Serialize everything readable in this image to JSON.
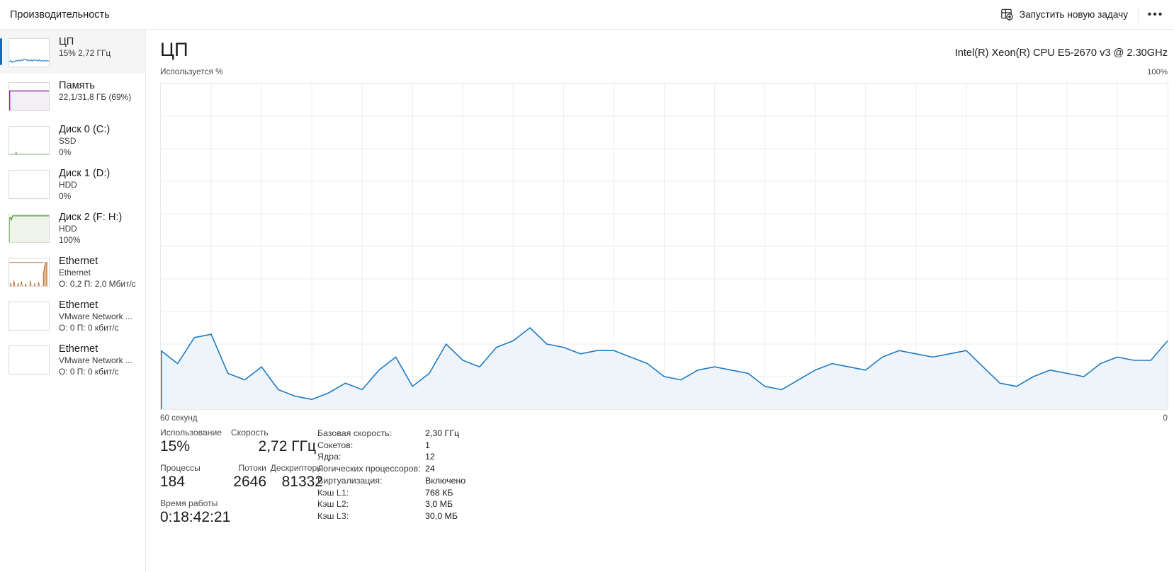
{
  "window": {
    "title": "Производительность",
    "new_task_label": "Запустить новую задачу",
    "new_task_icon": "new-window-plus-icon",
    "more_label": "•••"
  },
  "sidebar": {
    "items": [
      {
        "name": "cpu",
        "title": "ЦП",
        "sub1": "15% 2,72 ГГц",
        "sub2": "",
        "selected": true,
        "accent": "#1f7bc1",
        "fill": "none",
        "thumb": "line"
      },
      {
        "name": "memory",
        "title": "Память",
        "sub1": "22,1/31,8 ГБ (69%)",
        "sub2": "",
        "selected": false,
        "accent": "#8d21b0",
        "fill": "#f4eff5",
        "thumb": "flat-high"
      },
      {
        "name": "disk-0",
        "title": "Диск 0 (C:)",
        "sub1": "SSD",
        "sub2": "0%",
        "selected": false,
        "accent": "#4f9e2f",
        "fill": "none",
        "thumb": "flat-zero"
      },
      {
        "name": "disk-1",
        "title": "Диск 1 (D:)",
        "sub1": "HDD",
        "sub2": "0%",
        "selected": false,
        "accent": "#4f9e2f",
        "fill": "none",
        "thumb": "empty"
      },
      {
        "name": "disk-2",
        "title": "Диск 2 (F: H:)",
        "sub1": "HDD",
        "sub2": "100%",
        "selected": false,
        "accent": "#4f9e2f",
        "fill": "#eef4e9",
        "thumb": "flat-full"
      },
      {
        "name": "ethernet-1",
        "title": "Ethernet",
        "sub1": "Ethernet",
        "sub2": "О: 0,2 П: 2,0 Мбит/с",
        "selected": false,
        "accent": "#b5621b",
        "fill": "#fbf4ed",
        "thumb": "spiky"
      },
      {
        "name": "ethernet-2",
        "title": "Ethernet",
        "sub1": "VMware Network ...",
        "sub2": "О: 0 П: 0 кбит/с",
        "selected": false,
        "accent": "#b5621b",
        "fill": "none",
        "thumb": "empty"
      },
      {
        "name": "ethernet-3",
        "title": "Ethernet",
        "sub1": "VMware Network ...",
        "sub2": "О: 0 П: 0 кбит/с",
        "selected": false,
        "accent": "#b5621b",
        "fill": "none",
        "thumb": "empty"
      }
    ]
  },
  "main": {
    "heading": "ЦП",
    "model": "Intel(R) Xeon(R) CPU E5-2670 v3 @ 2.30GHz",
    "graph_top_left_label": "Используется %",
    "graph_top_right_label": "100%",
    "graph_bottom_left_label": "60 секунд",
    "graph_bottom_right_label": "0",
    "colors": {
      "line": "#1f7bc1",
      "fill": "#eef4fa",
      "grid": "#e9eef2",
      "accent": "#0f6cbd"
    }
  },
  "chart_data": {
    "type": "area",
    "title": "ЦП — Используется %",
    "xlabel": "60 секунд",
    "ylabel": "Используется %",
    "ylim": [
      0,
      100
    ],
    "xlim": [
      60,
      0
    ],
    "grid": true,
    "legend": "none",
    "series": [
      {
        "name": "Используется %",
        "values": [
          18,
          14,
          22,
          23,
          11,
          9,
          13,
          6,
          4,
          3,
          5,
          8,
          6,
          12,
          16,
          7,
          11,
          20,
          15,
          13,
          19,
          21,
          25,
          20,
          19,
          17,
          18,
          18,
          16,
          14,
          10,
          9,
          12,
          13,
          12,
          11,
          7,
          6,
          9,
          12,
          14,
          13,
          12,
          16,
          18,
          17,
          16,
          17,
          18,
          13,
          8,
          7,
          10,
          12,
          11,
          10,
          14,
          16,
          15,
          15,
          21
        ]
      }
    ]
  },
  "stats": {
    "utilization_label": "Использование",
    "utilization_value": "15%",
    "speed_label": "Скорость",
    "speed_value": "2,72 ГГц",
    "processes_label": "Процессы",
    "processes_value": "184",
    "threads_label": "Потоки",
    "threads_value": "2646",
    "handles_label": "Дескрипторы",
    "handles_value": "81332",
    "uptime_label": "Время работы",
    "uptime_value": "0:18:42:21"
  },
  "specs": [
    {
      "key": "Базовая скорость:",
      "value": "2,30 ГГц"
    },
    {
      "key": "Сокетов:",
      "value": "1"
    },
    {
      "key": "Ядра:",
      "value": "12"
    },
    {
      "key": "Логических процессоров:",
      "value": "24"
    },
    {
      "key": "Виртуализация:",
      "value": "Включено"
    },
    {
      "key": "Кэш L1:",
      "value": "768 КБ"
    },
    {
      "key": "Кэш L2:",
      "value": "3,0 МБ"
    },
    {
      "key": "Кэш L3:",
      "value": "30,0 МБ"
    }
  ]
}
